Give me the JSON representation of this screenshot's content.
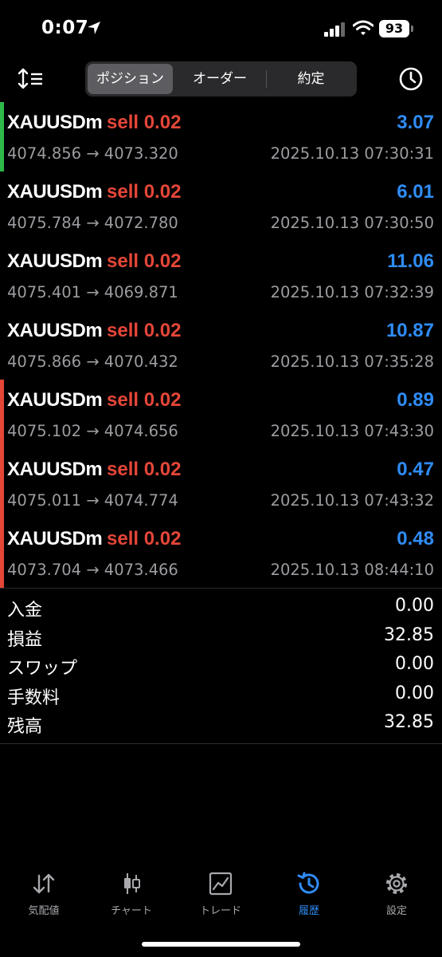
{
  "status": {
    "time": "0:07",
    "battery": "93"
  },
  "segments": [
    "ポジション",
    "オーダー",
    "約定"
  ],
  "colors": {
    "accent": "#2f8cf5",
    "sell": "#e54638",
    "profit_bar": "#2eb84a",
    "loss_bar": "#e54638"
  },
  "deals": [
    {
      "symbol": "XAUUSDm",
      "side": "sell 0.02",
      "profit": "3.07",
      "open_price": "4074.856",
      "close_price": "4073.320",
      "time": "2025.10.13 07:30:31",
      "bar": "green"
    },
    {
      "symbol": "XAUUSDm",
      "side": "sell 0.02",
      "profit": "6.01",
      "open_price": "4075.784",
      "close_price": "4072.780",
      "time": "2025.10.13 07:30:50",
      "bar": "none"
    },
    {
      "symbol": "XAUUSDm",
      "side": "sell 0.02",
      "profit": "11.06",
      "open_price": "4075.401",
      "close_price": "4069.871",
      "time": "2025.10.13 07:32:39",
      "bar": "none"
    },
    {
      "symbol": "XAUUSDm",
      "side": "sell 0.02",
      "profit": "10.87",
      "open_price": "4075.866",
      "close_price": "4070.432",
      "time": "2025.10.13 07:35:28",
      "bar": "none"
    },
    {
      "symbol": "XAUUSDm",
      "side": "sell 0.02",
      "profit": "0.89",
      "open_price": "4075.102",
      "close_price": "4074.656",
      "time": "2025.10.13 07:43:30",
      "bar": "red"
    },
    {
      "symbol": "XAUUSDm",
      "side": "sell 0.02",
      "profit": "0.47",
      "open_price": "4075.011",
      "close_price": "4074.774",
      "time": "2025.10.13 07:43:32",
      "bar": "red"
    },
    {
      "symbol": "XAUUSDm",
      "side": "sell 0.02",
      "profit": "0.48",
      "open_price": "4073.704",
      "close_price": "4073.466",
      "time": "2025.10.13 08:44:10",
      "bar": "red"
    }
  ],
  "summary": [
    {
      "label": "入金",
      "value": "0.00"
    },
    {
      "label": "損益",
      "value": "32.85"
    },
    {
      "label": "スワップ",
      "value": "0.00"
    },
    {
      "label": "手数料",
      "value": "0.00"
    },
    {
      "label": "残高",
      "value": "32.85"
    }
  ],
  "tabs": [
    {
      "label": "気配値",
      "icon": "arrows-updown-icon"
    },
    {
      "label": "チャート",
      "icon": "candlestick-icon"
    },
    {
      "label": "トレード",
      "icon": "line-chart-icon"
    },
    {
      "label": "履歴",
      "icon": "history-icon",
      "active": true
    },
    {
      "label": "設定",
      "icon": "gear-icon"
    }
  ]
}
